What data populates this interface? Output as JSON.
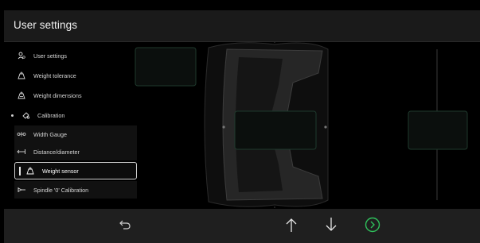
{
  "header": {
    "title": "User settings"
  },
  "menu": {
    "items": [
      {
        "label": "User settings",
        "icon": "user-settings-icon"
      },
      {
        "label": "Weight tolerance",
        "icon": "weight-tolerance-icon"
      },
      {
        "label": "Weight dimensions",
        "icon": "weight-dimensions-icon"
      },
      {
        "label": "Calibration",
        "icon": "calibration-icon"
      },
      {
        "label": "Width Gauge",
        "icon": "width-gauge-icon"
      },
      {
        "label": "Distance/diameter",
        "icon": "distance-diameter-icon"
      },
      {
        "label": "Weight sensor",
        "icon": "weight-sensor-icon",
        "selected": true
      },
      {
        "label": "Spindle '0' Calibration",
        "icon": "spindle-calibration-icon"
      }
    ]
  },
  "toolbar": {
    "buttons": [
      "back-icon",
      "arrow-up-icon",
      "arrow-down-icon",
      "next-circle-icon"
    ]
  },
  "colors": {
    "background": "#000000",
    "panel": "#1f1f1f",
    "accent_green": "#2fbf5b",
    "highlight_border": "#cfcfcf"
  }
}
